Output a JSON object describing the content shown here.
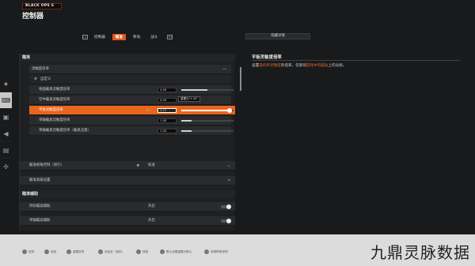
{
  "brand": {
    "logo_text": "BLACK OPS 6"
  },
  "header": {
    "title": "控制器"
  },
  "tabs": {
    "left_key": "L1",
    "right_key": "R1",
    "items": [
      {
        "label": "控制器",
        "active": false
      },
      {
        "label": "瞄准",
        "active": true
      },
      {
        "label": "移动",
        "active": false
      },
      {
        "label": "战斗",
        "active": false
      }
    ],
    "side_button": "隐藏详情"
  },
  "sidebar": {
    "items": [
      {
        "icon": "star-icon",
        "glyph": "★",
        "active": false
      },
      {
        "icon": "controller-icon",
        "glyph": "🎮",
        "active": true
      },
      {
        "icon": "monitor-icon",
        "glyph": "▣",
        "active": false
      },
      {
        "icon": "speaker-icon",
        "glyph": "🔊",
        "active": false
      },
      {
        "icon": "interface-icon",
        "glyph": "▤",
        "active": false
      },
      {
        "icon": "network-icon",
        "glyph": "✣",
        "active": false
      }
    ]
  },
  "sections": {
    "aim": "瞄准",
    "aim_assist": "瞄准辅助"
  },
  "rows": {
    "sensitivity_header": "灵敏度倍率",
    "custom_label": "自定义",
    "r1": {
      "label": "地面载具灵敏度倍率",
      "value": "4.00",
      "fill": 0.5
    },
    "r2": {
      "label": "空中载具灵敏度倍率",
      "value": "4.00",
      "tooltip": "重置为\"1.00\""
    },
    "r3": {
      "label": "平板灵敏度倍率",
      "value": "3.57",
      "fill": 0.9
    },
    "r4": {
      "label": "单轴载具灵敏度倍率",
      "value": "1.00",
      "fill": 0.2
    },
    "r5": {
      "label": "单轴载具灵敏度倍率（载具注意）",
      "value": "1.00",
      "fill": 0.2
    },
    "r6": {
      "label": "瞄准视角控制（进行）",
      "option": "标准"
    },
    "r7": {
      "label": "瞄准高级设置"
    },
    "r8": {
      "label": "目标瞄准辅助",
      "option": "开启"
    },
    "r9": {
      "label": "单轴瞄准辅助",
      "option": "开启"
    }
  },
  "info": {
    "title": "平板灵敏度倍率",
    "desc_pre": "设置",
    "desc_hl1": "操作杆灵敏度",
    "desc_mid": "的倍率，仅影响",
    "desc_hl2": "游戏中的瞄准",
    "desc_post": "上的光标。"
  },
  "hints": [
    {
      "label": "选择"
    },
    {
      "label": "返回"
    },
    {
      "label": "重置选项"
    },
    {
      "label": "添加至「我的」"
    },
    {
      "label": "搜索"
    },
    {
      "label": "默认设置重置为默认"
    },
    {
      "label": "查看帮助说明"
    }
  ],
  "watermark": "九鼎灵脉数据"
}
